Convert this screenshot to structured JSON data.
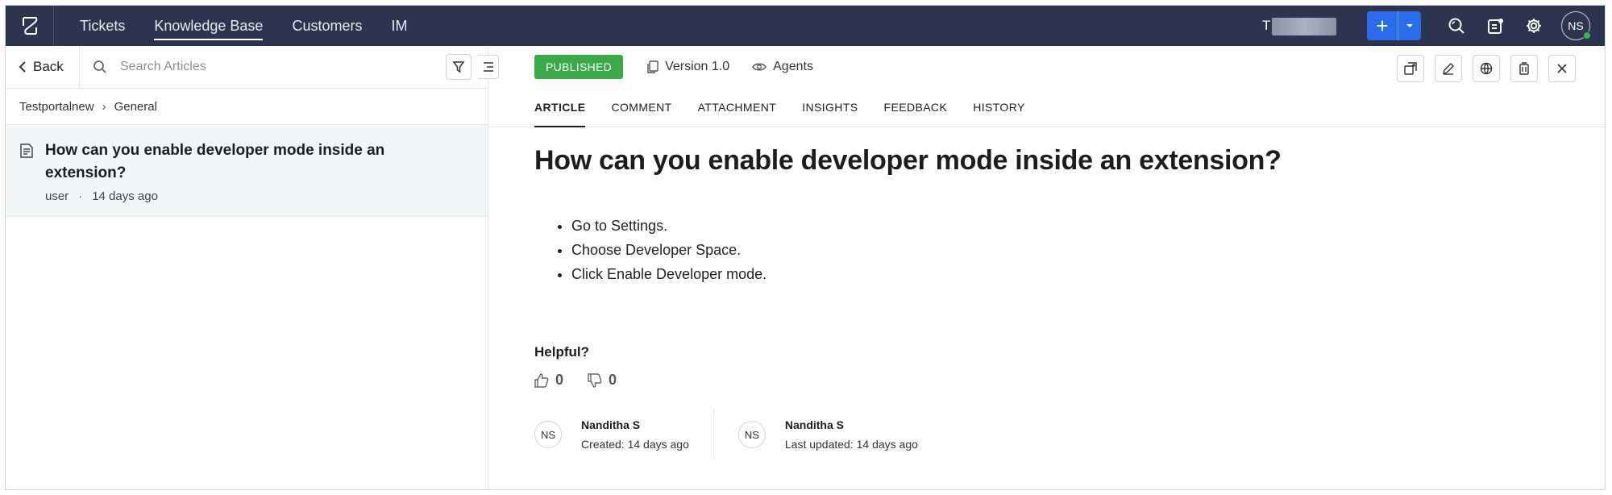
{
  "nav": {
    "items": [
      {
        "label": "Tickets",
        "active": false
      },
      {
        "label": "Knowledge Base",
        "active": true
      },
      {
        "label": "Customers",
        "active": false
      },
      {
        "label": "IM",
        "active": false
      }
    ],
    "portal_name": "T",
    "user_initials": "NS"
  },
  "left": {
    "back_label": "Back",
    "search_placeholder": "Search Articles",
    "breadcrumb": [
      "Testportalnew",
      "General"
    ],
    "article": {
      "title": "How can you enable developer mode inside an extension?",
      "author": "user",
      "time": "14 days ago"
    }
  },
  "right": {
    "status": "PUBLISHED",
    "version": "Version 1.0",
    "visibility": "Agents",
    "tabs": [
      "ARTICLE",
      "COMMENT",
      "ATTACHMENT",
      "INSIGHTS",
      "FEEDBACK",
      "HISTORY"
    ],
    "active_tab": "ARTICLE",
    "title": "How can you enable developer mode inside an extension?",
    "steps": [
      "Go to Settings.",
      "Choose Developer Space.",
      "Click Enable Developer mode."
    ],
    "helpful_label": "Helpful?",
    "likes": "0",
    "dislikes": "0",
    "created": {
      "initials": "NS",
      "name": "Nanditha S",
      "label": "Created: 14 days ago"
    },
    "updated": {
      "initials": "NS",
      "name": "Nanditha S",
      "label": "Last updated: 14 days ago"
    }
  },
  "colors": {
    "topbar": "#2c3450",
    "accent": "#2b6de8",
    "published": "#3ba94a"
  }
}
